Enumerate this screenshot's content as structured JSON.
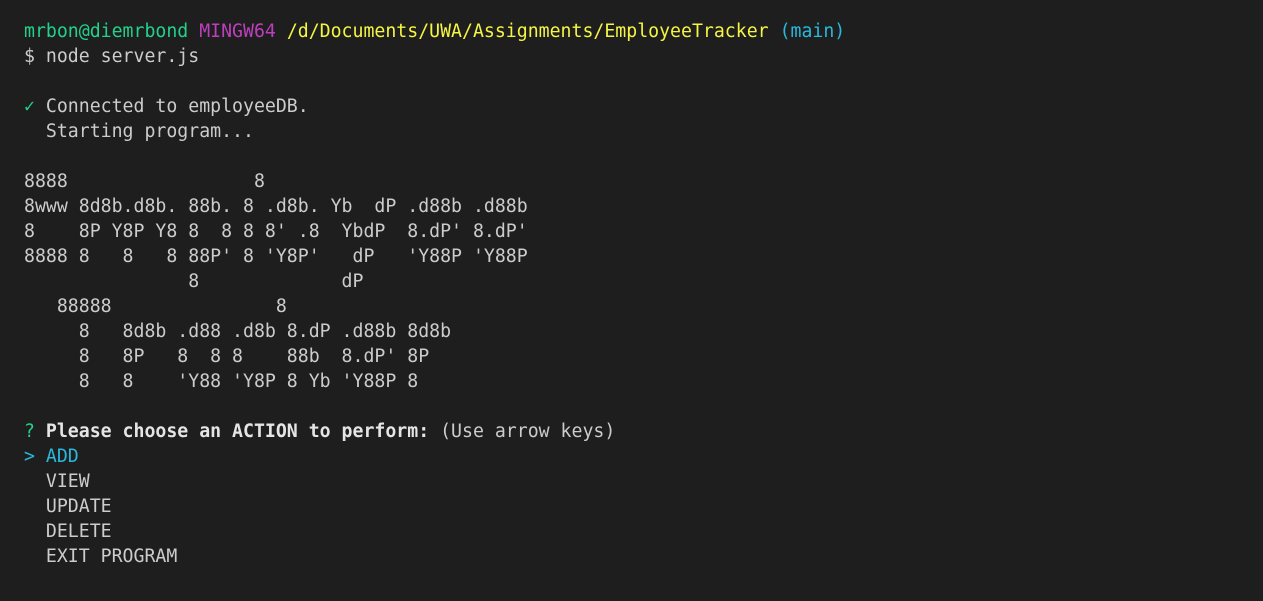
{
  "prompt_header": {
    "user_host": "mrbon@diemrbond",
    "shell": "MINGW64",
    "path": "/d/Documents/UWA/Assignments/EmployeeTracker",
    "branch": "(main)"
  },
  "command": {
    "symbol": "$",
    "text": "node server.js"
  },
  "status": {
    "check_symbol": "✓",
    "connected": "Connected to employeeDB.",
    "starting": "  Starting program..."
  },
  "banner": [
    "8888                 8",
    "8www 8d8b.d8b. 88b. 8 .d8b. Yb  dP .d88b .d88b",
    "8    8P Y8P Y8 8  8 8 8' .8  YbdP  8.dP' 8.dP'",
    "8888 8   8   8 88P' 8 'Y8P'   dP   'Y88P 'Y88P",
    "               8             dP",
    "   88888               8",
    "     8   8d8b .d88 .d8b 8.dP .d88b 8d8b",
    "     8   8P   8  8 8    88b  8.dP' 8P",
    "     8   8    'Y88 'Y8P 8 Yb 'Y88P 8"
  ],
  "question": {
    "symbol": "?",
    "text": "Please choose an ACTION to perform:",
    "hint": "(Use arrow keys)"
  },
  "menu": {
    "pointer": ">",
    "items": [
      "ADD",
      "VIEW",
      "UPDATE",
      "DELETE",
      "EXIT PROGRAM"
    ],
    "selected_index": 0
  },
  "colors": {
    "background": "#1e1e1e",
    "green": "#23d18b",
    "magenta": "#bc3fbc",
    "yellow": "#f5f543",
    "cyan": "#29b8db",
    "text": "#cccccc"
  }
}
